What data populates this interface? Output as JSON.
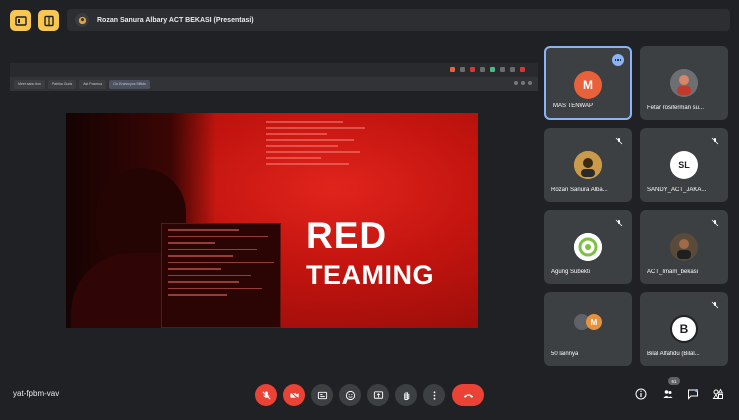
{
  "presenter": {
    "label": "Rozan Sanura Albary ACT BEKASI (Presentasi)"
  },
  "browser": {
    "tabs": [
      "Meet sabu tion",
      "Patrika Guds",
      "Ast Posmoa",
      "Cic Endsrcyos Slffcts"
    ]
  },
  "slide": {
    "title_line1": "RED",
    "title_line2": "TEAMING"
  },
  "participants": [
    {
      "name": "MAS TENWAP",
      "initial": "M",
      "avatar_color": "#e8613b",
      "active": true
    },
    {
      "name": "Fetar rosiferman su...",
      "initial": "",
      "avatar_color": "#5f6368",
      "active": false
    },
    {
      "name": "Rozan Sanura Alba...",
      "initial": "",
      "avatar_color": "#d8a24a",
      "active": false
    },
    {
      "name": "SANDY_ACT_JAKA...",
      "initial": "SL",
      "avatar_color": "#ffffff",
      "active": false
    },
    {
      "name": "Agung Subekti",
      "initial": "",
      "avatar_color": "#7bc142",
      "active": false
    },
    {
      "name": "ACT_Imam_bekasi",
      "initial": "",
      "avatar_color": "#4a3a30",
      "active": false
    },
    {
      "name": "50 lainnya",
      "initial": "M",
      "avatar_color": "#e8913b",
      "active": false
    },
    {
      "name": "Bilal Alfafidu (Bilal...",
      "initial": "B",
      "avatar_color": "#ffffff",
      "active": false
    }
  ],
  "footer": {
    "meeting_code": "yat-fpbm-vav",
    "participant_count": "61"
  },
  "colors": {
    "accent_yellow": "#f9c74f",
    "control_red": "#ea4335",
    "active_border": "#8ab4f8"
  }
}
